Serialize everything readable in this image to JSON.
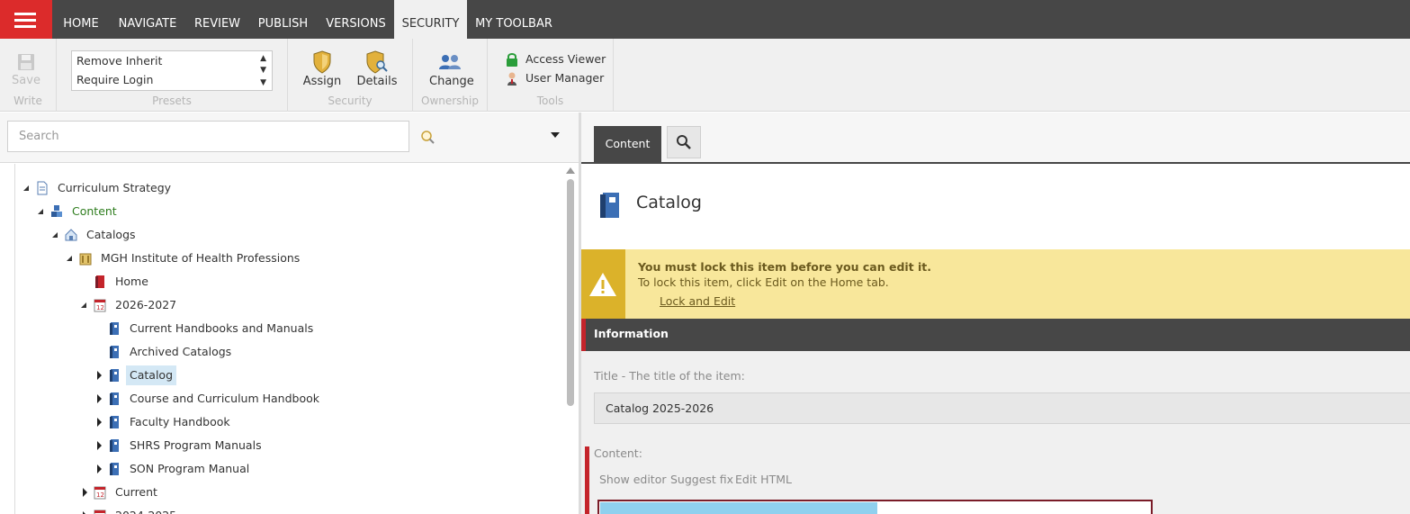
{
  "menu": {
    "tabs": [
      {
        "label": "HOME"
      },
      {
        "label": "NAVIGATE"
      },
      {
        "label": "REVIEW"
      },
      {
        "label": "PUBLISH"
      },
      {
        "label": "VERSIONS"
      },
      {
        "label": "SECURITY",
        "active": true
      },
      {
        "label": "MY TOOLBAR"
      }
    ]
  },
  "ribbon": {
    "write": {
      "save_label": "Save",
      "group_label": "Write"
    },
    "presets": {
      "options": [
        "Remove Inherit",
        "Require Login"
      ],
      "group_label": "Presets"
    },
    "security": {
      "assign_label": "Assign",
      "details_label": "Details",
      "group_label": "Security"
    },
    "ownership": {
      "change_label": "Change",
      "group_label": "Ownership"
    },
    "tools": {
      "access_viewer_label": "Access Viewer",
      "user_manager_label": "User Manager",
      "group_label": "Tools"
    }
  },
  "search": {
    "placeholder": "Search",
    "value": ""
  },
  "tree": {
    "nodes": [
      {
        "label": "Curriculum Strategy",
        "icon": "document-icon"
      },
      {
        "label": "Content",
        "icon": "content-cubes-icon"
      },
      {
        "label": "Catalogs",
        "icon": "catalogs-home-icon"
      },
      {
        "label": "MGH Institute of Health Professions",
        "icon": "institution-icon"
      },
      {
        "label": "Home",
        "icon": "home-book-icon"
      },
      {
        "label": "2026-2027",
        "icon": "calendar-icon"
      },
      {
        "label": "Current Handbooks and Manuals",
        "icon": "book-icon"
      },
      {
        "label": "Archived Catalogs",
        "icon": "book-icon"
      },
      {
        "label": "Catalog",
        "icon": "book-icon",
        "selected": true
      },
      {
        "label": "Course and Curriculum Handbook",
        "icon": "book-icon"
      },
      {
        "label": "Faculty Handbook",
        "icon": "book-icon"
      },
      {
        "label": "SHRS Program Manuals",
        "icon": "book-icon"
      },
      {
        "label": "SON Program Manual",
        "icon": "book-icon"
      },
      {
        "label": "Current",
        "icon": "calendar-icon"
      },
      {
        "label": "2024-2025",
        "icon": "calendar-icon"
      }
    ]
  },
  "editor": {
    "tabs": {
      "content_label": "Content"
    },
    "item_title": "Catalog",
    "warning": {
      "title": "You must lock this item before you can edit it.",
      "text": "To lock this item, click Edit on the Home tab.",
      "link": "Lock and Edit"
    },
    "section_title": "Information",
    "title_field": {
      "label": "Title - The title of the item:",
      "value": "Catalog 2025-2026"
    },
    "content_field": {
      "label": "Content:",
      "actions": [
        "Show editor",
        "Suggest fix",
        "Edit HTML"
      ]
    }
  },
  "colors": {
    "menubar": "#474747",
    "hamburger": "#dc2b2b",
    "warning_bg": "#f8e79b",
    "warning_side": "#dbb22a",
    "section_accent": "#c4242b",
    "selected_bg": "#d4e8f5",
    "green_text": "#2e7d1e"
  }
}
